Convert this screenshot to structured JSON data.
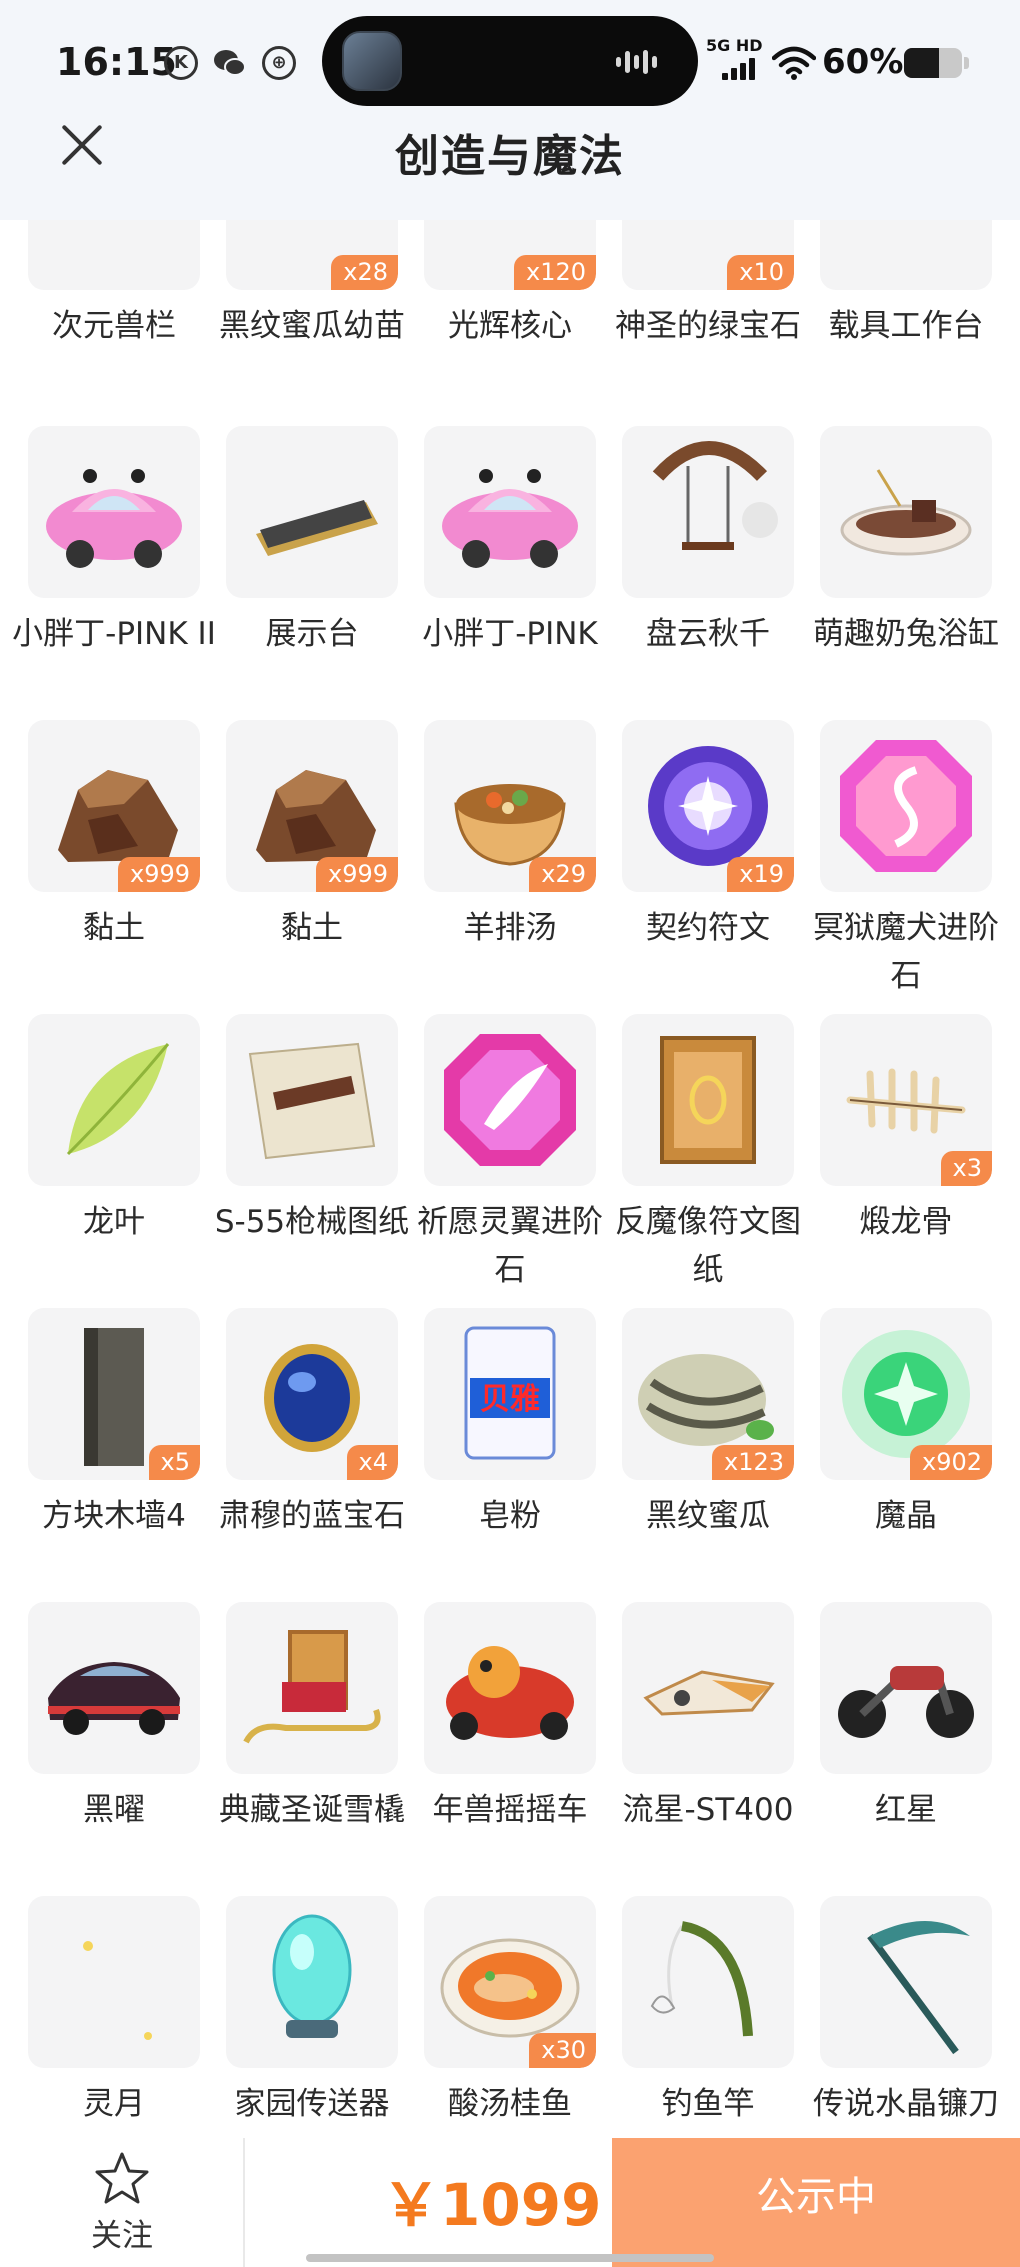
{
  "status_bar": {
    "time": "16:15",
    "network": "5G HD",
    "battery_percent": "60%",
    "battery_level": 0.6,
    "icons": [
      "k-circle-icon",
      "wechat-icon",
      "app-circle-icon"
    ]
  },
  "header": {
    "title": "创造与魔法",
    "close_icon": "close-icon"
  },
  "items": [
    {
      "name": "次元兽栏",
      "badge": "",
      "icon": "fence"
    },
    {
      "name": "黑纹蜜瓜幼苗",
      "badge": "x28",
      "icon": "seedling"
    },
    {
      "name": "光辉核心",
      "badge": "x120",
      "icon": "core"
    },
    {
      "name": "神圣的绿宝石",
      "badge": "x10",
      "icon": "emerald"
    },
    {
      "name": "载具工作台",
      "badge": "",
      "icon": "workbench"
    },
    {
      "name": "小胖丁-PINK II",
      "badge": "",
      "icon": "pink-car"
    },
    {
      "name": "展示台",
      "badge": "",
      "icon": "display-stand"
    },
    {
      "name": "小胖丁-PINK",
      "badge": "",
      "icon": "pink-car"
    },
    {
      "name": "盘云秋千",
      "badge": "",
      "icon": "swing"
    },
    {
      "name": "萌趣奶兔浴缸",
      "badge": "",
      "icon": "bathtub"
    },
    {
      "name": "黏土",
      "badge": "x999",
      "icon": "clay"
    },
    {
      "name": "黏土",
      "badge": "x999",
      "icon": "clay"
    },
    {
      "name": "羊排汤",
      "badge": "x29",
      "icon": "soup"
    },
    {
      "name": "契约符文",
      "badge": "x19",
      "icon": "rune"
    },
    {
      "name": "冥狱魔犬进阶石",
      "badge": "",
      "icon": "gem-pink"
    },
    {
      "name": "龙叶",
      "badge": "",
      "icon": "leaf"
    },
    {
      "name": "S-55枪械图纸",
      "badge": "",
      "icon": "blueprint"
    },
    {
      "name": "祈愿灵翼进阶石",
      "badge": "",
      "icon": "gem-wing"
    },
    {
      "name": "反魔像符文图纸",
      "badge": "",
      "icon": "scroll"
    },
    {
      "name": "煅龙骨",
      "badge": "x3",
      "icon": "bone"
    },
    {
      "name": "方块木墙4",
      "badge": "x5",
      "icon": "wall"
    },
    {
      "name": "肃穆的蓝宝石",
      "badge": "x4",
      "icon": "sapphire"
    },
    {
      "name": "皂粉",
      "badge": "",
      "icon": "soap"
    },
    {
      "name": "黑纹蜜瓜",
      "badge": "x123",
      "icon": "melon"
    },
    {
      "name": "魔晶",
      "badge": "x902",
      "icon": "crystal"
    },
    {
      "name": "黑曜",
      "badge": "",
      "icon": "dark-car"
    },
    {
      "name": "典藏圣诞雪橇",
      "badge": "",
      "icon": "sleigh"
    },
    {
      "name": "年兽摇摇车",
      "badge": "",
      "icon": "kart"
    },
    {
      "name": "流星-ST400",
      "badge": "",
      "icon": "hoverbike"
    },
    {
      "name": "红星",
      "badge": "",
      "icon": "motorbike"
    },
    {
      "name": "灵月",
      "badge": "",
      "icon": "moon"
    },
    {
      "name": "家园传送器",
      "badge": "",
      "icon": "teleporter"
    },
    {
      "name": "酸汤桂鱼",
      "badge": "x30",
      "icon": "fish-dish"
    },
    {
      "name": "钓鱼竿",
      "badge": "",
      "icon": "rod"
    },
    {
      "name": "传说水晶镰刀",
      "badge": "",
      "icon": "scythe"
    }
  ],
  "bottom_bar": {
    "follow_label": "关注",
    "follow_icon": "star-icon",
    "price": "￥1099",
    "cta_label": "公示中"
  },
  "colors": {
    "accent": "#f47a1f",
    "cta_bg": "#fba270",
    "badge_bg": "#f58a4a"
  }
}
